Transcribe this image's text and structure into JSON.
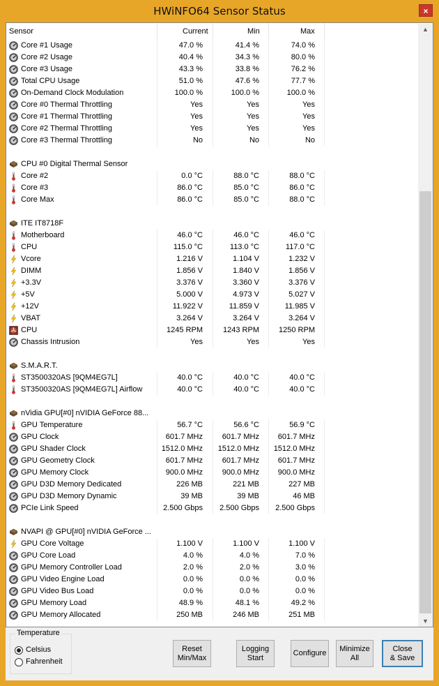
{
  "window": {
    "title": "HWiNFO64 Sensor Status",
    "close_glyph": "×"
  },
  "columns": {
    "sensor": "Sensor",
    "current": "Current",
    "min": "Min",
    "max": "Max"
  },
  "rows": [
    {
      "type": "data",
      "icon": "gauge",
      "name": "Core #1 Usage",
      "cur": "47.0 %",
      "min": "41.4 %",
      "max": "74.0 %"
    },
    {
      "type": "data",
      "icon": "gauge",
      "name": "Core #2 Usage",
      "cur": "40.4 %",
      "min": "34.3 %",
      "max": "80.0 %"
    },
    {
      "type": "data",
      "icon": "gauge",
      "name": "Core #3 Usage",
      "cur": "43.3 %",
      "min": "33.8 %",
      "max": "76.2 %"
    },
    {
      "type": "data",
      "icon": "gauge",
      "name": "Total CPU Usage",
      "cur": "51.0 %",
      "min": "47.6 %",
      "max": "77.7 %"
    },
    {
      "type": "data",
      "icon": "gauge",
      "name": "On-Demand Clock Modulation",
      "cur": "100.0 %",
      "min": "100.0 %",
      "max": "100.0 %"
    },
    {
      "type": "data",
      "icon": "gauge",
      "name": "Core #0 Thermal Throttling",
      "cur": "Yes",
      "min": "Yes",
      "max": "Yes"
    },
    {
      "type": "data",
      "icon": "gauge",
      "name": "Core #1 Thermal Throttling",
      "cur": "Yes",
      "min": "Yes",
      "max": "Yes"
    },
    {
      "type": "data",
      "icon": "gauge",
      "name": "Core #2 Thermal Throttling",
      "cur": "Yes",
      "min": "Yes",
      "max": "Yes"
    },
    {
      "type": "data",
      "icon": "gauge",
      "name": "Core #3 Thermal Throttling",
      "cur": "No",
      "min": "No",
      "max": "No"
    },
    {
      "type": "blank"
    },
    {
      "type": "group",
      "icon": "chip",
      "name": "CPU #0 Digital Thermal Sensor"
    },
    {
      "type": "data",
      "icon": "thermo",
      "name": "Core #2",
      "cur": "0.0 °C",
      "min": "88.0 °C",
      "max": "88.0 °C"
    },
    {
      "type": "data",
      "icon": "thermo",
      "name": "Core #3",
      "cur": "86.0 °C",
      "min": "85.0 °C",
      "max": "86.0 °C"
    },
    {
      "type": "data",
      "icon": "thermo",
      "name": "Core Max",
      "cur": "86.0 °C",
      "min": "85.0 °C",
      "max": "88.0 °C"
    },
    {
      "type": "blank"
    },
    {
      "type": "group",
      "icon": "chip",
      "name": "ITE IT8718F"
    },
    {
      "type": "data",
      "icon": "thermo",
      "name": "Motherboard",
      "cur": "46.0 °C",
      "min": "46.0 °C",
      "max": "46.0 °C"
    },
    {
      "type": "data",
      "icon": "thermo",
      "name": "CPU",
      "cur": "115.0 °C",
      "min": "113.0 °C",
      "max": "117.0 °C"
    },
    {
      "type": "data",
      "icon": "bolt",
      "name": "Vcore",
      "cur": "1.216 V",
      "min": "1.104 V",
      "max": "1.232 V"
    },
    {
      "type": "data",
      "icon": "bolt",
      "name": "DIMM",
      "cur": "1.856 V",
      "min": "1.840 V",
      "max": "1.856 V"
    },
    {
      "type": "data",
      "icon": "bolt",
      "name": "+3.3V",
      "cur": "3.376 V",
      "min": "3.360 V",
      "max": "3.376 V"
    },
    {
      "type": "data",
      "icon": "bolt",
      "name": "+5V",
      "cur": "5.000 V",
      "min": "4.973 V",
      "max": "5.027 V"
    },
    {
      "type": "data",
      "icon": "bolt",
      "name": "+12V",
      "cur": "11.922 V",
      "min": "11.859 V",
      "max": "11.985 V"
    },
    {
      "type": "data",
      "icon": "bolt",
      "name": "VBAT",
      "cur": "3.264 V",
      "min": "3.264 V",
      "max": "3.264 V"
    },
    {
      "type": "data",
      "icon": "fan",
      "name": "CPU",
      "cur": "1245 RPM",
      "min": "1243 RPM",
      "max": "1250 RPM"
    },
    {
      "type": "data",
      "icon": "gauge",
      "name": "Chassis Intrusion",
      "cur": "Yes",
      "min": "Yes",
      "max": "Yes"
    },
    {
      "type": "blank"
    },
    {
      "type": "group",
      "icon": "chip",
      "name": "S.M.A.R.T."
    },
    {
      "type": "data",
      "icon": "thermo",
      "name": "ST3500320AS [9QM4EG7L]",
      "cur": "40.0 °C",
      "min": "40.0 °C",
      "max": "40.0 °C"
    },
    {
      "type": "data",
      "icon": "thermo",
      "name": "ST3500320AS [9QM4EG7L] Airflow",
      "cur": "40.0 °C",
      "min": "40.0 °C",
      "max": "40.0 °C"
    },
    {
      "type": "blank"
    },
    {
      "type": "group",
      "icon": "chip",
      "name": "nVidia GPU[#0] nVIDIA GeForce 88..."
    },
    {
      "type": "data",
      "icon": "thermo",
      "name": "GPU Temperature",
      "cur": "56.7 °C",
      "min": "56.6 °C",
      "max": "56.9 °C"
    },
    {
      "type": "data",
      "icon": "gauge",
      "name": "GPU Clock",
      "cur": "601.7 MHz",
      "min": "601.7 MHz",
      "max": "601.7 MHz"
    },
    {
      "type": "data",
      "icon": "gauge",
      "name": "GPU Shader Clock",
      "cur": "1512.0 MHz",
      "min": "1512.0 MHz",
      "max": "1512.0 MHz"
    },
    {
      "type": "data",
      "icon": "gauge",
      "name": "GPU Geometry Clock",
      "cur": "601.7 MHz",
      "min": "601.7 MHz",
      "max": "601.7 MHz"
    },
    {
      "type": "data",
      "icon": "gauge",
      "name": "GPU Memory Clock",
      "cur": "900.0 MHz",
      "min": "900.0 MHz",
      "max": "900.0 MHz"
    },
    {
      "type": "data",
      "icon": "gauge",
      "name": "GPU D3D Memory Dedicated",
      "cur": "226 MB",
      "min": "221 MB",
      "max": "227 MB"
    },
    {
      "type": "data",
      "icon": "gauge",
      "name": "GPU D3D Memory Dynamic",
      "cur": "39 MB",
      "min": "39 MB",
      "max": "46 MB"
    },
    {
      "type": "data",
      "icon": "gauge",
      "name": "PCIe Link Speed",
      "cur": "2.500 Gbps",
      "min": "2.500 Gbps",
      "max": "2.500 Gbps"
    },
    {
      "type": "blank"
    },
    {
      "type": "group",
      "icon": "chip",
      "name": "NVAPI @ GPU[#0] nVIDIA GeForce ..."
    },
    {
      "type": "data",
      "icon": "bolt",
      "name": "GPU Core Voltage",
      "cur": "1.100 V",
      "min": "1.100 V",
      "max": "1.100 V"
    },
    {
      "type": "data",
      "icon": "gauge",
      "name": "GPU Core Load",
      "cur": "4.0 %",
      "min": "4.0 %",
      "max": "7.0 %"
    },
    {
      "type": "data",
      "icon": "gauge",
      "name": "GPU Memory Controller Load",
      "cur": "2.0 %",
      "min": "2.0 %",
      "max": "3.0 %"
    },
    {
      "type": "data",
      "icon": "gauge",
      "name": "GPU Video Engine Load",
      "cur": "0.0 %",
      "min": "0.0 %",
      "max": "0.0 %"
    },
    {
      "type": "data",
      "icon": "gauge",
      "name": "GPU Video Bus Load",
      "cur": "0.0 %",
      "min": "0.0 %",
      "max": "0.0 %"
    },
    {
      "type": "data",
      "icon": "gauge",
      "name": "GPU Memory Load",
      "cur": "48.9 %",
      "min": "48.1 %",
      "max": "49.2 %"
    },
    {
      "type": "data",
      "icon": "gauge",
      "name": "GPU Memory Allocated",
      "cur": "250 MB",
      "min": "246 MB",
      "max": "251 MB"
    }
  ],
  "temperature": {
    "label": "Temperature",
    "celsius": "Celsius",
    "fahrenheit": "Fahrenheit",
    "selected": "celsius"
  },
  "buttons": {
    "reset": "Reset\nMin/Max",
    "logging": "Logging\nStart",
    "configure": "Configure",
    "minimize": "Minimize\nAll",
    "close": "Close\n& Save"
  },
  "colors": {
    "title_bar": "#e8a628",
    "close_button": "#c8382b",
    "default_button_border": "#3c7fb1"
  }
}
